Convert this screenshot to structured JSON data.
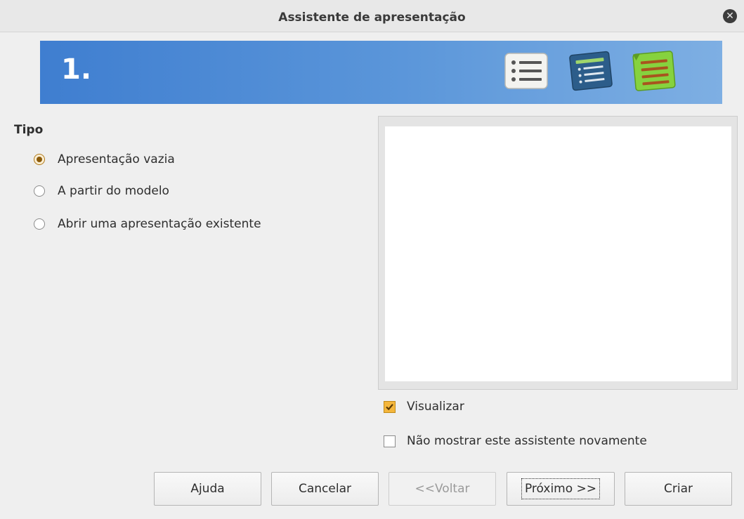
{
  "dialog": {
    "title": "Assistente de apresentação"
  },
  "banner": {
    "step": "1."
  },
  "type_group": {
    "label": "Tipo",
    "options": [
      {
        "label": "Apresentação vazia",
        "checked": true
      },
      {
        "label": "A partir do modelo",
        "checked": false
      },
      {
        "label": "Abrir uma apresentação existente",
        "checked": false
      }
    ]
  },
  "options": {
    "preview_label": "Visualizar",
    "preview_checked": true,
    "dont_show_label": "Não mostrar este assistente novamente",
    "dont_show_checked": false
  },
  "buttons": {
    "help": "Ajuda",
    "cancel": "Cancelar",
    "back": "<<Voltar",
    "next": "Próximo >>",
    "create": "Criar"
  },
  "colors": {
    "accent": "#f4b63c",
    "banner": "#4a86d4"
  }
}
